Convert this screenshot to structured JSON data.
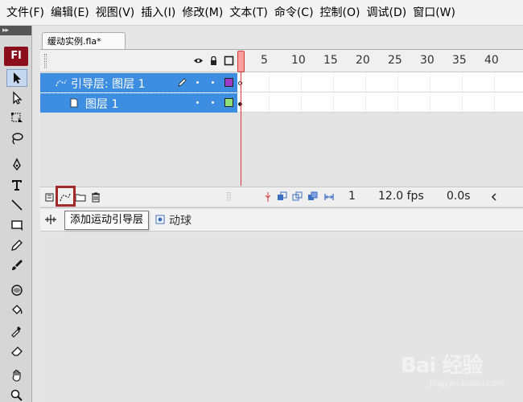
{
  "menu": [
    "文件(F)",
    "编辑(E)",
    "视图(V)",
    "插入(I)",
    "修改(M)",
    "文本(T)",
    "命令(C)",
    "控制(O)",
    "调试(D)",
    "窗口(W)"
  ],
  "toolstrip": {
    "header": "▸▸",
    "logo": "Fl"
  },
  "document": {
    "tab_title": "缓动实例.fla*"
  },
  "timeline": {
    "ruler": [
      "5",
      "10",
      "15",
      "20",
      "25",
      "30",
      "35",
      "40"
    ],
    "layers": [
      {
        "name": "引导层: 图层 1",
        "type": "guide",
        "color": "#9b3dc8"
      },
      {
        "name": "图层 1",
        "type": "normal",
        "color": "#8fe07a"
      }
    ],
    "footer": {
      "current_frame": "1",
      "fps": "12.0 fps",
      "elapsed": "0.0s"
    },
    "tooltip": "添加运动引导层"
  },
  "edit_bar": {
    "scene_label": "动球"
  },
  "watermark": {
    "main": "Bai 经验",
    "sub": "jingyan.baidu.com"
  }
}
